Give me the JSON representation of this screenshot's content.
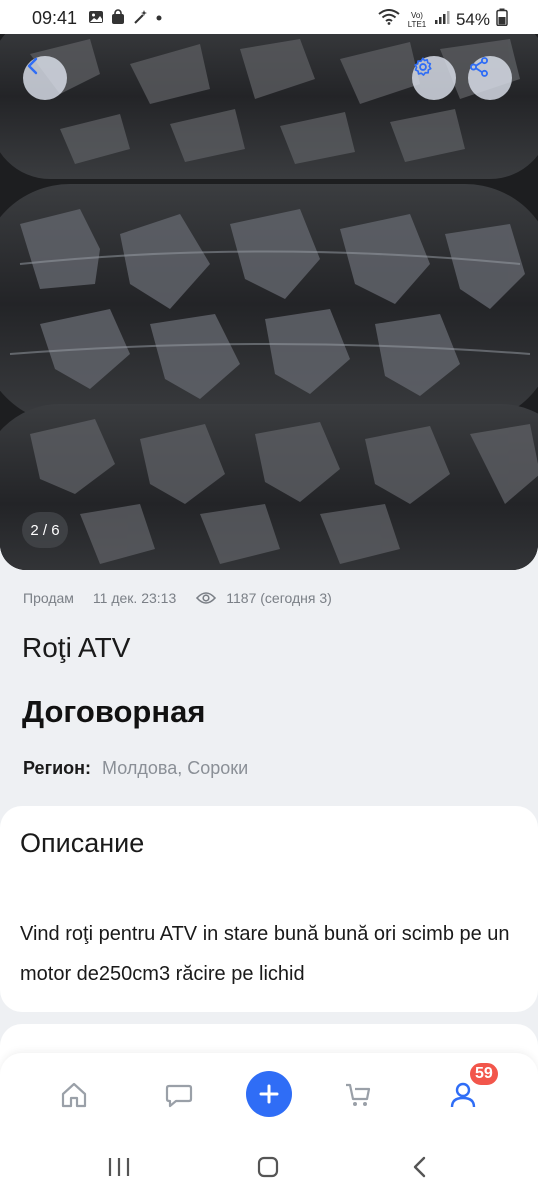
{
  "status_bar": {
    "time": "09:41",
    "battery": "54%",
    "network_label": "Vo) LTE1"
  },
  "gallery": {
    "counter": "2 / 6"
  },
  "listing": {
    "type": "Продам",
    "date": "11 дек. 23:13",
    "views": "1187 (сегодня 3)",
    "title": "Roţi ATV",
    "price": "Договорная",
    "region_label": "Регион:",
    "region_value": "Молдова, Сороки"
  },
  "description": {
    "title": "Описание",
    "text": "Vind roţi pentru ATV in stare bună bună ori scimb pe un motor de250cm3 răcire pe lichid"
  },
  "bottom_nav": {
    "profile_badge": "59"
  },
  "colors": {
    "accent": "#2f6df6",
    "badge": "#f2564b",
    "muted_text": "#7a7f86"
  }
}
